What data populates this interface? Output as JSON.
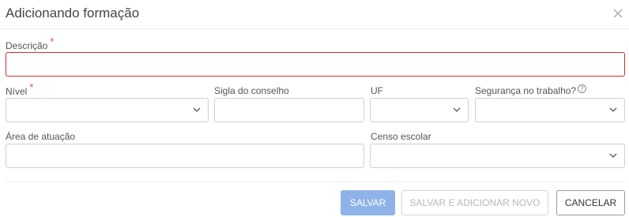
{
  "dialog": {
    "title": "Adicionando formação"
  },
  "form": {
    "descricao": {
      "label": "Descrição",
      "required_mark": "*",
      "value": ""
    },
    "nivel": {
      "label": "Nível",
      "required_mark": "*",
      "value": ""
    },
    "sigla_conselho": {
      "label": "Sigla do conselho",
      "value": ""
    },
    "uf": {
      "label": "UF",
      "value": ""
    },
    "seguranca_trabalho": {
      "label": "Segurança no trabalho?",
      "help_icon": "?",
      "value": ""
    },
    "area_atuacao": {
      "label": "Área de atuação",
      "value": ""
    },
    "censo_escolar": {
      "label": "Censo escolar",
      "value": ""
    }
  },
  "actions": {
    "save": "SALVAR",
    "save_and_new": "SALVAR E ADICIONAR NOVO",
    "cancel": "CANCELAR"
  },
  "colors": {
    "error_border": "#c9302c",
    "required_mark": "#d9534f",
    "primary_disabled": "#8fb3e8"
  },
  "icons": {
    "close": "close-icon",
    "dropdown": "chevron-down-icon",
    "help": "help-icon"
  }
}
